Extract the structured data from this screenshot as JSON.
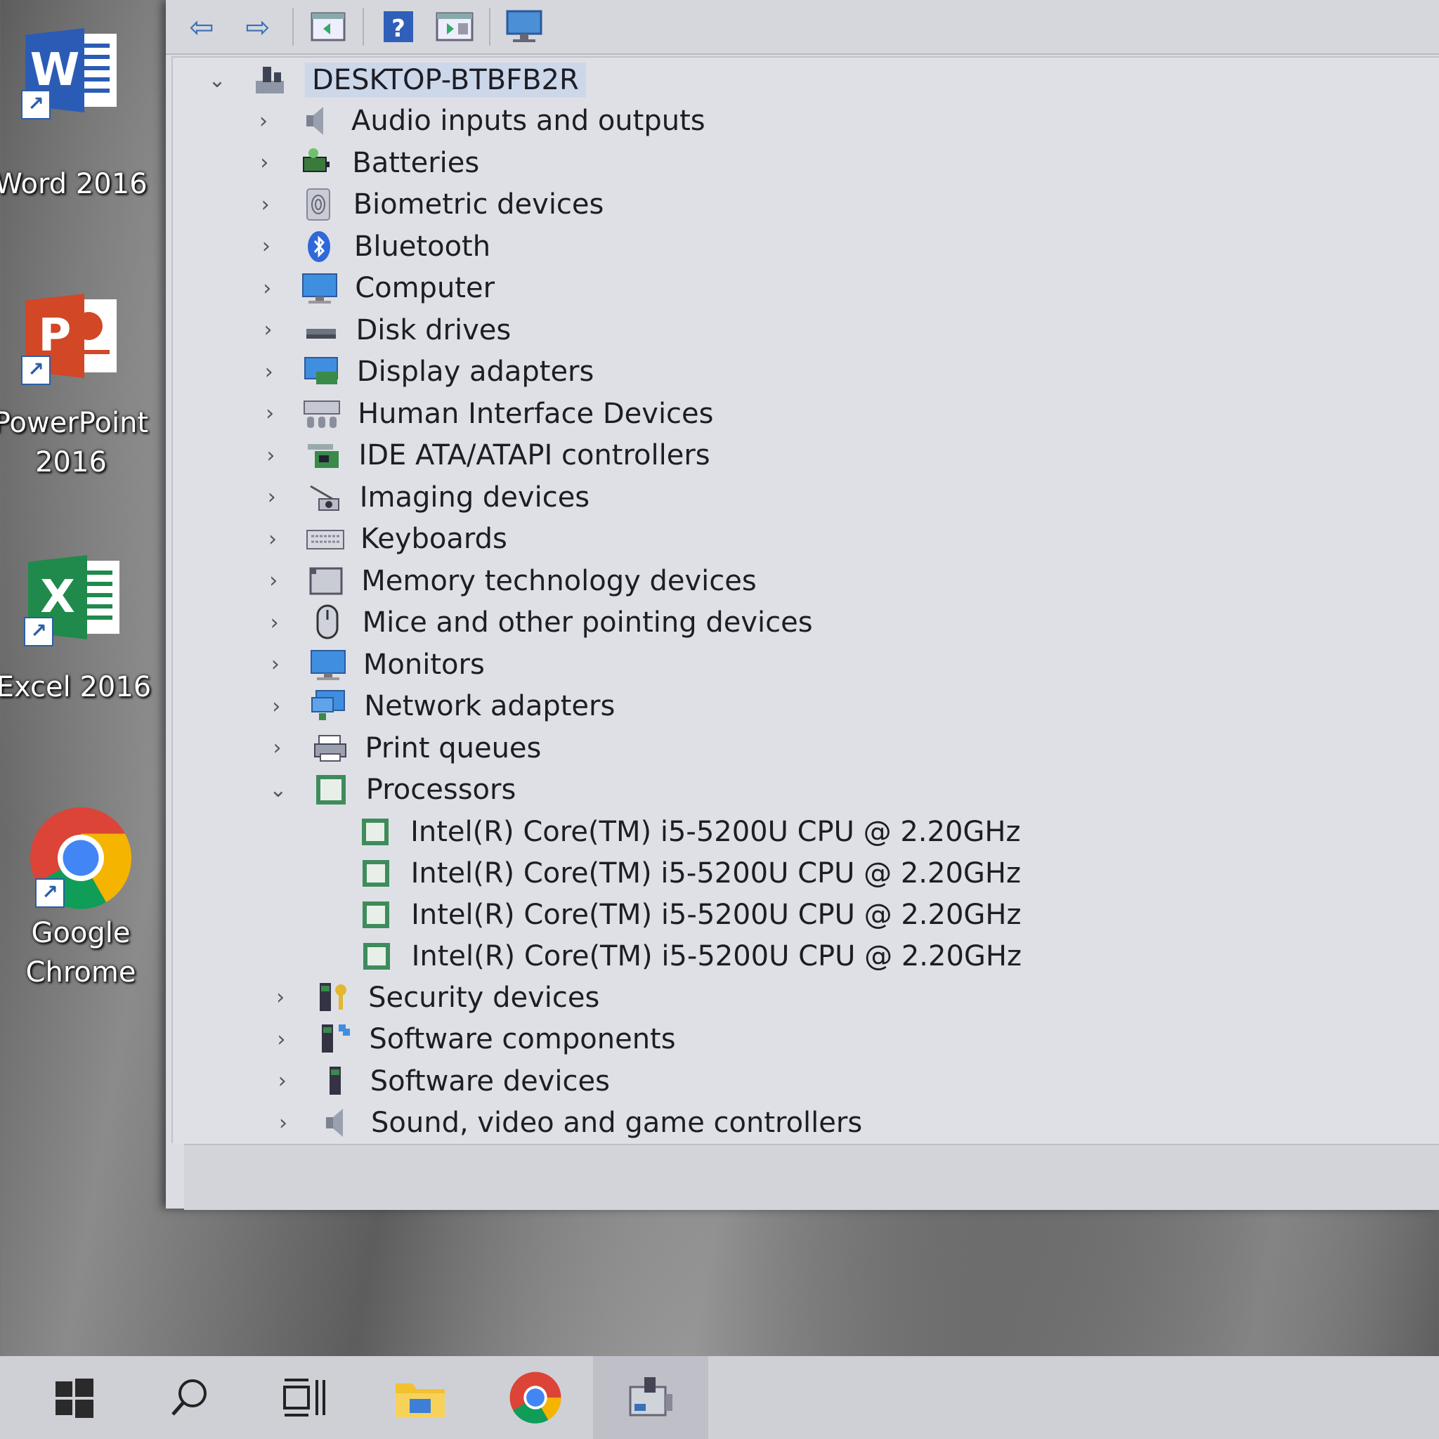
{
  "desktop": {
    "icons": [
      {
        "label": "Word 2016",
        "letter": "W",
        "color": "#2b5cb5"
      },
      {
        "label": "PowerPoint\n2016",
        "letter": "P",
        "color": "#d24726"
      },
      {
        "label": "Excel 2016",
        "letter": "X",
        "color": "#1f8a4c"
      },
      {
        "label": "Google\nChrome"
      }
    ]
  },
  "device_manager": {
    "computer_name": "DESKTOP-BTBFB2R",
    "categories": [
      {
        "label": "Audio inputs and outputs",
        "icon": "speaker-icon"
      },
      {
        "label": "Batteries",
        "icon": "battery-icon"
      },
      {
        "label": "Biometric devices",
        "icon": "fingerprint-icon"
      },
      {
        "label": "Bluetooth",
        "icon": "bluetooth-icon"
      },
      {
        "label": "Computer",
        "icon": "monitor-icon"
      },
      {
        "label": "Disk drives",
        "icon": "disk-drive-icon"
      },
      {
        "label": "Display adapters",
        "icon": "display-adapter-icon"
      },
      {
        "label": "Human Interface Devices",
        "icon": "hid-icon"
      },
      {
        "label": "IDE ATA/ATAPI controllers",
        "icon": "ide-controller-icon"
      },
      {
        "label": "Imaging devices",
        "icon": "camera-icon"
      },
      {
        "label": "Keyboards",
        "icon": "keyboard-icon"
      },
      {
        "label": "Memory technology devices",
        "icon": "memory-card-icon"
      },
      {
        "label": "Mice and other pointing devices",
        "icon": "mouse-icon"
      },
      {
        "label": "Monitors",
        "icon": "monitor-icon"
      },
      {
        "label": "Network adapters",
        "icon": "network-adapter-icon"
      },
      {
        "label": "Print queues",
        "icon": "printer-icon"
      },
      {
        "label": "Processors",
        "icon": "processor-icon",
        "expanded": true
      },
      {
        "label": "Security devices",
        "icon": "security-device-icon"
      },
      {
        "label": "Software components",
        "icon": "software-component-icon"
      },
      {
        "label": "Software devices",
        "icon": "software-device-icon"
      },
      {
        "label": "Sound, video and game controllers",
        "icon": "sound-icon"
      }
    ],
    "processors": [
      "Intel(R) Core(TM) i5-5200U CPU @ 2.20GHz",
      "Intel(R) Core(TM) i5-5200U CPU @ 2.20GHz",
      "Intel(R) Core(TM) i5-5200U CPU @ 2.20GHz",
      "Intel(R) Core(TM) i5-5200U CPU @ 2.20GHz"
    ]
  },
  "toolbar": {
    "buttons": [
      "back-icon",
      "forward-icon",
      "show-hide-console-tree-icon",
      "help-icon",
      "properties-icon",
      "scan-hardware-icon"
    ]
  },
  "taskbar": {
    "items": [
      "windows-start-icon",
      "search-icon",
      "task-view-icon",
      "file-explorer-icon",
      "chrome-icon",
      "device-manager-icon"
    ]
  },
  "colors": {
    "accent": "#3b6fb6",
    "processor_green": "#3e8c5c",
    "selection": "#cdd7ea"
  }
}
